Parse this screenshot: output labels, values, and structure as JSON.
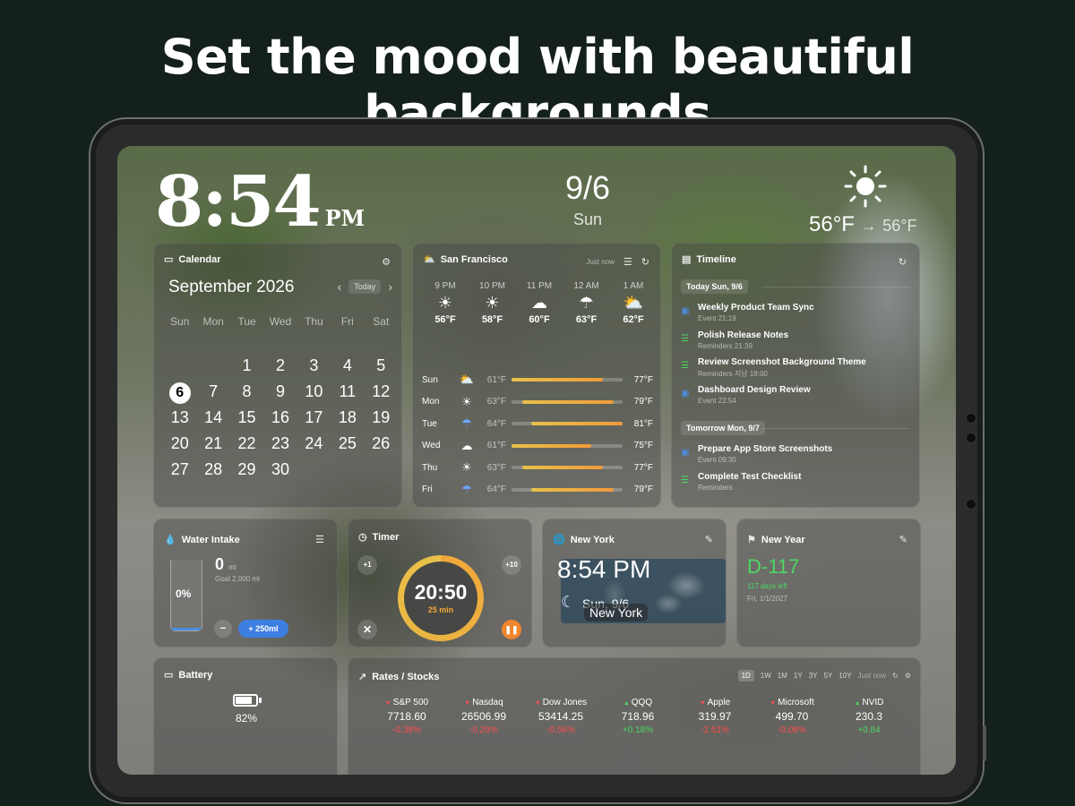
{
  "headline": "Set the mood with beautiful backgrounds",
  "clock": {
    "time": "8:54",
    "ampm": "PM"
  },
  "date": {
    "date": "9/6",
    "day": "Sun"
  },
  "current_weather": {
    "temp": "56°F",
    "arrow": "→",
    "next": "56°F"
  },
  "calendar": {
    "title": "Calendar",
    "month": "September 2026",
    "today_label": "Today",
    "weekdays": [
      "Sun",
      "Mon",
      "Tue",
      "Wed",
      "Thu",
      "Fri",
      "Sat"
    ],
    "days": [
      "",
      "",
      "",
      "",
      "",
      "",
      "",
      "",
      "",
      "1",
      "2",
      "3",
      "4",
      "5",
      "6",
      "7",
      "8",
      "9",
      "10",
      "11",
      "12",
      "13",
      "14",
      "15",
      "16",
      "17",
      "18",
      "19",
      "20",
      "21",
      "22",
      "23",
      "24",
      "25",
      "26",
      "27",
      "28",
      "29",
      "30",
      "",
      "",
      ""
    ],
    "today": "6"
  },
  "weather": {
    "location": "San Francisco",
    "updated": "Just now",
    "hourly": [
      {
        "time": "9 PM",
        "icon": "sun",
        "temp": "56°F"
      },
      {
        "time": "10 PM",
        "icon": "sun",
        "temp": "58°F"
      },
      {
        "time": "11 PM",
        "icon": "cloud",
        "temp": "60°F"
      },
      {
        "time": "12 AM",
        "icon": "rain-cloud",
        "temp": "63°F"
      },
      {
        "time": "1 AM",
        "icon": "partly-cloudy",
        "temp": "62°F"
      }
    ],
    "daily": [
      {
        "day": "Sun",
        "icon": "partly-cloudy",
        "low": "61°F",
        "high": "77°F",
        "from": 0.0,
        "to": 0.82
      },
      {
        "day": "Mon",
        "icon": "sun",
        "low": "63°F",
        "high": "79°F",
        "from": 0.1,
        "to": 0.92
      },
      {
        "day": "Tue",
        "icon": "rain-cloud",
        "low": "64°F",
        "high": "81°F",
        "from": 0.18,
        "to": 1.0
      },
      {
        "day": "Wed",
        "icon": "cloud",
        "low": "61°F",
        "high": "75°F",
        "from": 0.0,
        "to": 0.72
      },
      {
        "day": "Thu",
        "icon": "sun",
        "low": "63°F",
        "high": "77°F",
        "from": 0.1,
        "to": 0.82
      },
      {
        "day": "Fri",
        "icon": "rain-cloud",
        "low": "64°F",
        "high": "79°F",
        "from": 0.18,
        "to": 0.92
      }
    ],
    "colors": {
      "bar_start": "#e8c14a",
      "bar_end": "#f09a3a"
    }
  },
  "timeline": {
    "title": "Timeline",
    "sections": [
      {
        "label": "Today Sun, 9/6",
        "items": [
          {
            "name": "Weekly Product Team Sync",
            "sub": "Event  21:19",
            "type": "event"
          },
          {
            "name": "Polish Release Notes",
            "sub": "Reminders  21:39",
            "type": "reminder"
          },
          {
            "name": "Review Screenshot Background Theme",
            "sub": "Reminders  지남 18:00",
            "type": "reminder"
          },
          {
            "name": "Dashboard Design Review",
            "sub": "Event  22:54",
            "type": "event"
          }
        ]
      },
      {
        "label": "Tomorrow Mon, 9/7",
        "items": [
          {
            "name": "Prepare App Store Screenshots",
            "sub": "Event  09:30",
            "type": "event"
          },
          {
            "name": "Complete Test Checklist",
            "sub": "Reminders",
            "type": "reminder"
          }
        ]
      }
    ]
  },
  "water": {
    "title": "Water Intake",
    "amount": "0",
    "unit": "ml",
    "goal": "Goal 2,000 ml",
    "percent_label": "0%",
    "fill": 0.0,
    "minus": "−",
    "add": "+ 250ml"
  },
  "timer": {
    "title": "Timer",
    "time": "20:50",
    "label": "25 min",
    "plus1": "+1",
    "plus10": "+10"
  },
  "world": {
    "title": "New York",
    "time": "8:54 PM",
    "date": "Sun, 9/6",
    "city": "New York"
  },
  "countdown": {
    "title": "New Year",
    "value": "D-117",
    "days_left": "117 days left",
    "date": "Fri, 1/1/2027",
    "color": "#4cd964"
  },
  "battery": {
    "title": "Battery",
    "percent": "82%",
    "level": 0.82
  },
  "stocks": {
    "title": "Rates / Stocks",
    "ranges": [
      "1D",
      "1W",
      "1M",
      "1Y",
      "3Y",
      "5Y",
      "10Y"
    ],
    "selected": "1D",
    "updated": "Just now",
    "items": [
      {
        "name": "S&P 500",
        "price": "7718.60",
        "change": "-0.38%",
        "dir": "down"
      },
      {
        "name": "Nasdaq",
        "price": "26506.99",
        "change": "-0.29%",
        "dir": "down"
      },
      {
        "name": "Dow Jones",
        "price": "53414.25",
        "change": "-0.56%",
        "dir": "down"
      },
      {
        "name": "QQQ",
        "price": "718.96",
        "change": "+0.18%",
        "dir": "up"
      },
      {
        "name": "Apple",
        "price": "319.97",
        "change": "-2.51%",
        "dir": "down"
      },
      {
        "name": "Microsoft",
        "price": "499.70",
        "change": "-0.08%",
        "dir": "down"
      },
      {
        "name": "NVID",
        "price": "230.3",
        "change": "+0.84",
        "dir": "up"
      }
    ]
  }
}
